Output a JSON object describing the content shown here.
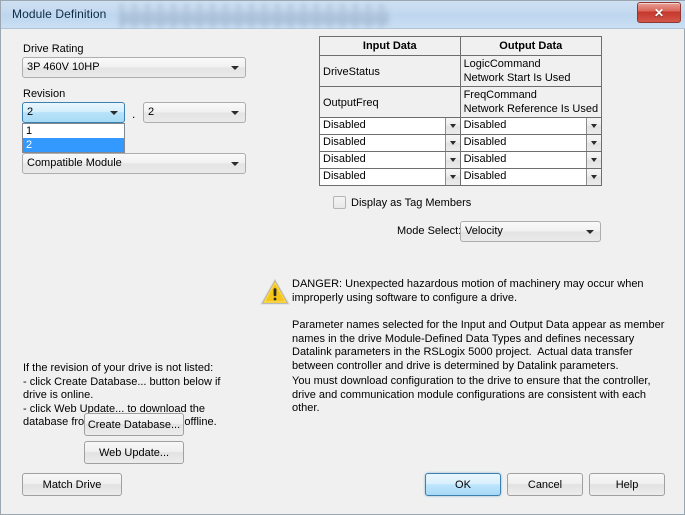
{
  "window": {
    "title": "Module Definition",
    "close_label": "✕",
    "close_icon": "close-icon",
    "titlebar_redacted": true
  },
  "left_panel": {
    "drive_rating_label": "Drive Rating",
    "drive_rating_value": "3P 460V  10HP",
    "revision_label": "Revision",
    "revision_major_value": "2",
    "revision_separator": ".",
    "revision_minor_value": "2",
    "revision_dropdown_open": true,
    "revision_options": [
      {
        "label": "1",
        "selected": false
      },
      {
        "label": "2",
        "selected": true
      }
    ],
    "electronic_keying_value": "Compatible Module",
    "note": "If the revision of your drive is not listed:\n- click Create Database... button below if\ndrive is online.\n- click Web Update... to download the\ndatabase from the web if drive is offline.",
    "create_database_label": "Create Database...",
    "web_update_label": "Web Update...",
    "match_drive_label": "Match Drive"
  },
  "data_table": {
    "headers": [
      "Input Data",
      "Output Data"
    ],
    "fixed_rows": [
      {
        "input": [
          "DriveStatus"
        ],
        "output": [
          "LogicCommand",
          "Network Start Is Used"
        ]
      },
      {
        "input": [
          "OutputFreq"
        ],
        "output": [
          "FreqCommand",
          "Network Reference Is Used"
        ]
      }
    ],
    "combo_rows": [
      {
        "input": "Disabled",
        "output": "Disabled"
      },
      {
        "input": "Disabled",
        "output": "Disabled"
      },
      {
        "input": "Disabled",
        "output": "Disabled"
      },
      {
        "input": "Disabled",
        "output": "Disabled"
      }
    ]
  },
  "options": {
    "display_as_tag_members_label": "Display as Tag Members",
    "display_as_tag_members_checked": false,
    "mode_select_label": "Mode Select:",
    "mode_select_value": "Velocity"
  },
  "warning": {
    "icon": "warning-triangle-icon",
    "paragraph1": "DANGER: Unexpected hazardous motion of machinery may occur when improperly using software to configure a drive.",
    "paragraph2": "Parameter names selected for the Input and Output Data appear as member names in the drive Module-Defined Data Types and defines necessary Datalink parameters in the RSLogix 5000 project.  Actual data transfer between controller and drive is determined by Datalink parameters.",
    "paragraph3": "You must download configuration to the drive to ensure that the controller, drive and communication module configurations are consistent with each other."
  },
  "footer": {
    "ok_label": "OK",
    "cancel_label": "Cancel",
    "help_label": "Help"
  },
  "colors": {
    "titlebar": "#c3d9ef",
    "close_red": "#c4382c",
    "dialog_bg": "#f0f0f0",
    "selection_blue": "#3399ff",
    "focus_blue": "#3c7fb1",
    "warning_yellow": "#ffd42a"
  }
}
